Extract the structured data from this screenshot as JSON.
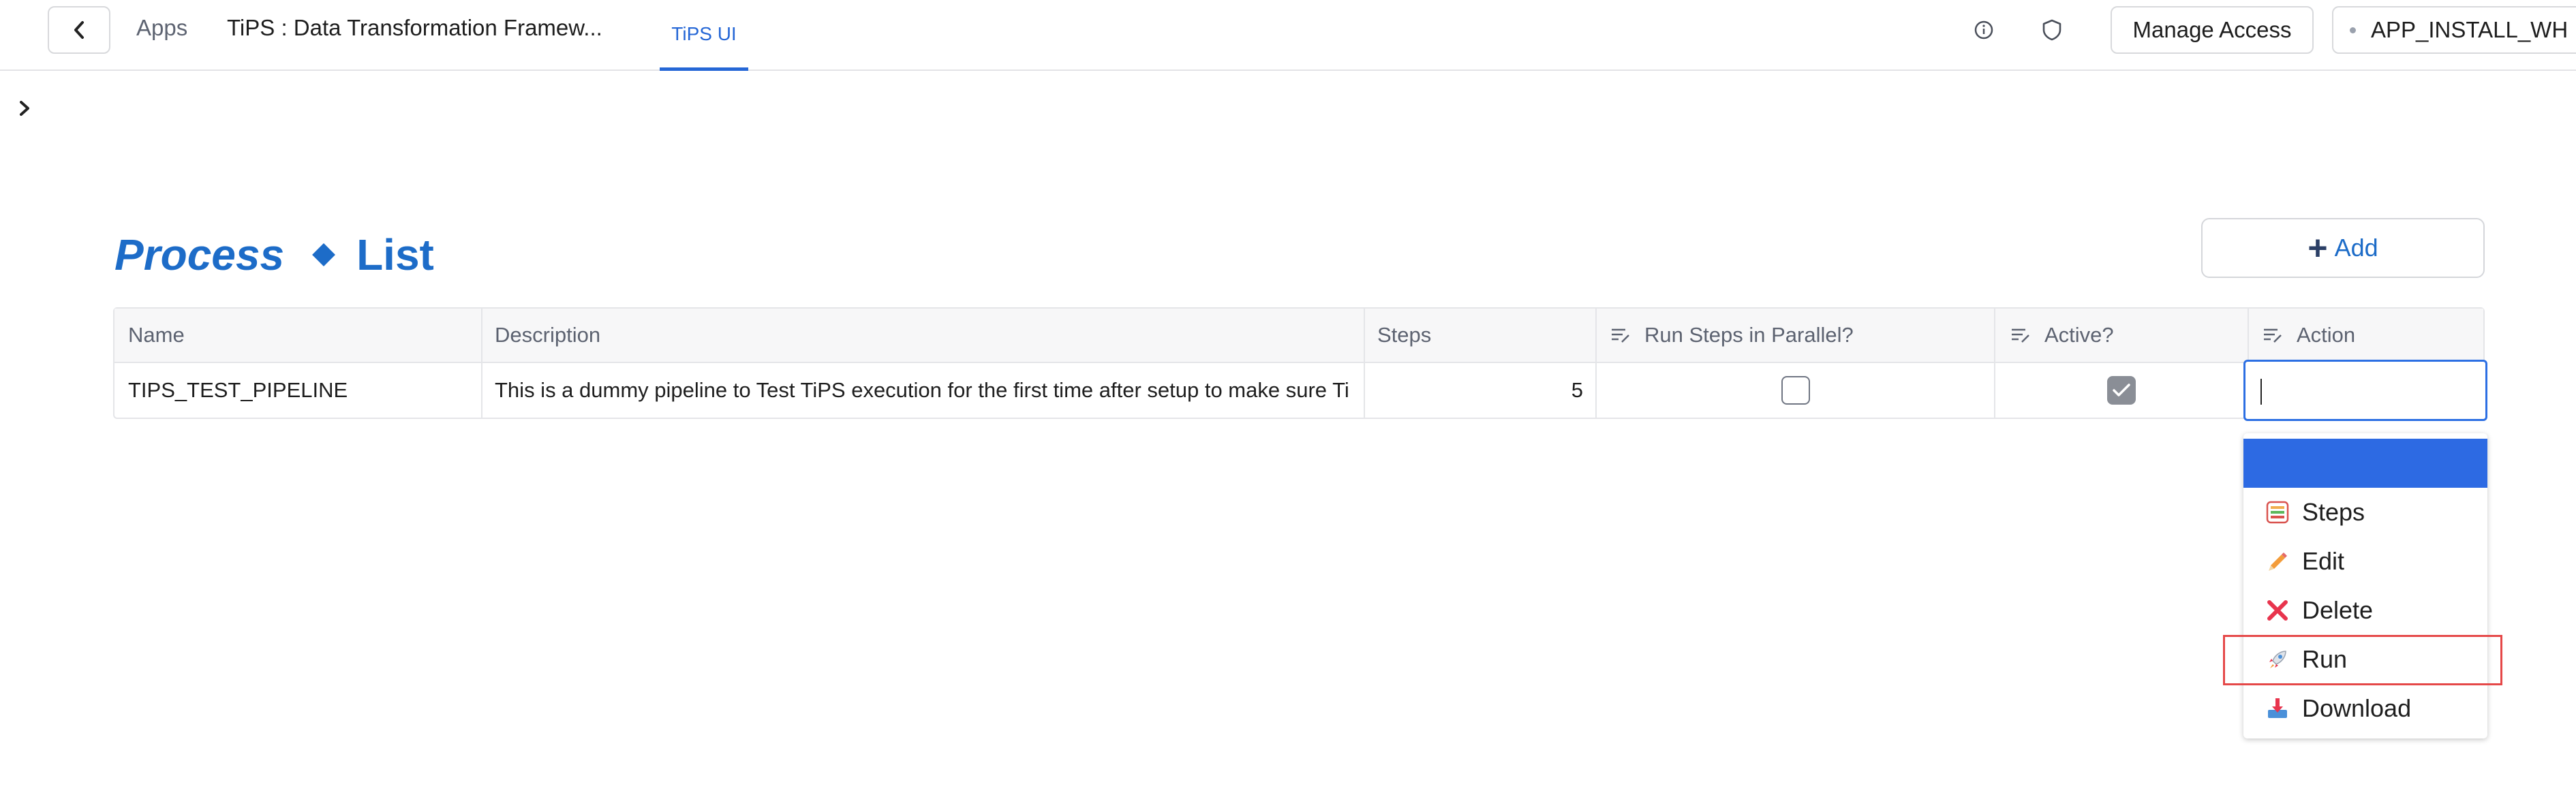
{
  "topbar": {
    "apps_label": "Apps",
    "app_name": "TiPS : Data Transformation Framew...",
    "active_tab": "TiPS UI",
    "manage_access_label": "Manage Access",
    "warehouse_label": "APP_INSTALL_WH"
  },
  "page": {
    "title_part1": "Process",
    "title_part2": "List",
    "add_label": "Add"
  },
  "table": {
    "columns": [
      "Name",
      "Description",
      "Steps",
      "Run Steps in Parallel?",
      "Active?",
      "Action"
    ],
    "rows": [
      {
        "name": "TIPS_TEST_PIPELINE",
        "description": "This is a dummy pipeline to Test TiPS execution for the first time after setup to make sure Ti",
        "steps": "5",
        "run_parallel": false,
        "active": true,
        "action_value": ""
      }
    ]
  },
  "action_menu": {
    "items": [
      {
        "label": "Steps",
        "icon": "steps-icon"
      },
      {
        "label": "Edit",
        "icon": "pencil-icon"
      },
      {
        "label": "Delete",
        "icon": "delete-x-icon"
      },
      {
        "label": "Run",
        "icon": "rocket-icon"
      },
      {
        "label": "Download",
        "icon": "download-tray-icon"
      }
    ],
    "highlighted_item": "Run"
  },
  "colors": {
    "accent": "#1d6cc8",
    "dropdown_highlight": "#2d6ae3",
    "annotation_box": "#e54848"
  }
}
